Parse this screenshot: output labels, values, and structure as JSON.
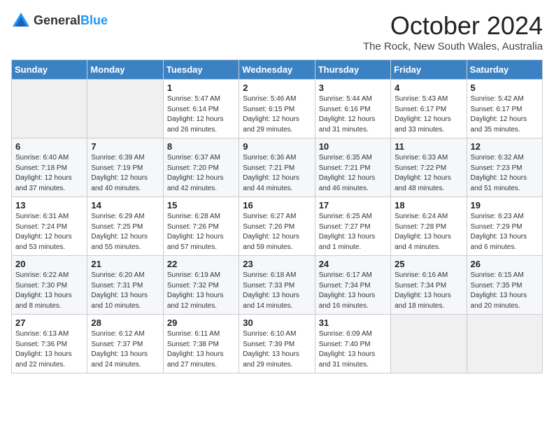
{
  "logo": {
    "general": "General",
    "blue": "Blue"
  },
  "title": "October 2024",
  "location": "The Rock, New South Wales, Australia",
  "days_of_week": [
    "Sunday",
    "Monday",
    "Tuesday",
    "Wednesday",
    "Thursday",
    "Friday",
    "Saturday"
  ],
  "weeks": [
    [
      {
        "day": "",
        "info": ""
      },
      {
        "day": "",
        "info": ""
      },
      {
        "day": "1",
        "info": "Sunrise: 5:47 AM\nSunset: 6:14 PM\nDaylight: 12 hours and 26 minutes."
      },
      {
        "day": "2",
        "info": "Sunrise: 5:46 AM\nSunset: 6:15 PM\nDaylight: 12 hours and 29 minutes."
      },
      {
        "day": "3",
        "info": "Sunrise: 5:44 AM\nSunset: 6:16 PM\nDaylight: 12 hours and 31 minutes."
      },
      {
        "day": "4",
        "info": "Sunrise: 5:43 AM\nSunset: 6:17 PM\nDaylight: 12 hours and 33 minutes."
      },
      {
        "day": "5",
        "info": "Sunrise: 5:42 AM\nSunset: 6:17 PM\nDaylight: 12 hours and 35 minutes."
      }
    ],
    [
      {
        "day": "6",
        "info": "Sunrise: 6:40 AM\nSunset: 7:18 PM\nDaylight: 12 hours and 37 minutes."
      },
      {
        "day": "7",
        "info": "Sunrise: 6:39 AM\nSunset: 7:19 PM\nDaylight: 12 hours and 40 minutes."
      },
      {
        "day": "8",
        "info": "Sunrise: 6:37 AM\nSunset: 7:20 PM\nDaylight: 12 hours and 42 minutes."
      },
      {
        "day": "9",
        "info": "Sunrise: 6:36 AM\nSunset: 7:21 PM\nDaylight: 12 hours and 44 minutes."
      },
      {
        "day": "10",
        "info": "Sunrise: 6:35 AM\nSunset: 7:21 PM\nDaylight: 12 hours and 46 minutes."
      },
      {
        "day": "11",
        "info": "Sunrise: 6:33 AM\nSunset: 7:22 PM\nDaylight: 12 hours and 48 minutes."
      },
      {
        "day": "12",
        "info": "Sunrise: 6:32 AM\nSunset: 7:23 PM\nDaylight: 12 hours and 51 minutes."
      }
    ],
    [
      {
        "day": "13",
        "info": "Sunrise: 6:31 AM\nSunset: 7:24 PM\nDaylight: 12 hours and 53 minutes."
      },
      {
        "day": "14",
        "info": "Sunrise: 6:29 AM\nSunset: 7:25 PM\nDaylight: 12 hours and 55 minutes."
      },
      {
        "day": "15",
        "info": "Sunrise: 6:28 AM\nSunset: 7:26 PM\nDaylight: 12 hours and 57 minutes."
      },
      {
        "day": "16",
        "info": "Sunrise: 6:27 AM\nSunset: 7:26 PM\nDaylight: 12 hours and 59 minutes."
      },
      {
        "day": "17",
        "info": "Sunrise: 6:25 AM\nSunset: 7:27 PM\nDaylight: 13 hours and 1 minute."
      },
      {
        "day": "18",
        "info": "Sunrise: 6:24 AM\nSunset: 7:28 PM\nDaylight: 13 hours and 4 minutes."
      },
      {
        "day": "19",
        "info": "Sunrise: 6:23 AM\nSunset: 7:29 PM\nDaylight: 13 hours and 6 minutes."
      }
    ],
    [
      {
        "day": "20",
        "info": "Sunrise: 6:22 AM\nSunset: 7:30 PM\nDaylight: 13 hours and 8 minutes."
      },
      {
        "day": "21",
        "info": "Sunrise: 6:20 AM\nSunset: 7:31 PM\nDaylight: 13 hours and 10 minutes."
      },
      {
        "day": "22",
        "info": "Sunrise: 6:19 AM\nSunset: 7:32 PM\nDaylight: 13 hours and 12 minutes."
      },
      {
        "day": "23",
        "info": "Sunrise: 6:18 AM\nSunset: 7:33 PM\nDaylight: 13 hours and 14 minutes."
      },
      {
        "day": "24",
        "info": "Sunrise: 6:17 AM\nSunset: 7:34 PM\nDaylight: 13 hours and 16 minutes."
      },
      {
        "day": "25",
        "info": "Sunrise: 6:16 AM\nSunset: 7:34 PM\nDaylight: 13 hours and 18 minutes."
      },
      {
        "day": "26",
        "info": "Sunrise: 6:15 AM\nSunset: 7:35 PM\nDaylight: 13 hours and 20 minutes."
      }
    ],
    [
      {
        "day": "27",
        "info": "Sunrise: 6:13 AM\nSunset: 7:36 PM\nDaylight: 13 hours and 22 minutes."
      },
      {
        "day": "28",
        "info": "Sunrise: 6:12 AM\nSunset: 7:37 PM\nDaylight: 13 hours and 24 minutes."
      },
      {
        "day": "29",
        "info": "Sunrise: 6:11 AM\nSunset: 7:38 PM\nDaylight: 13 hours and 27 minutes."
      },
      {
        "day": "30",
        "info": "Sunrise: 6:10 AM\nSunset: 7:39 PM\nDaylight: 13 hours and 29 minutes."
      },
      {
        "day": "31",
        "info": "Sunrise: 6:09 AM\nSunset: 7:40 PM\nDaylight: 13 hours and 31 minutes."
      },
      {
        "day": "",
        "info": ""
      },
      {
        "day": "",
        "info": ""
      }
    ]
  ]
}
